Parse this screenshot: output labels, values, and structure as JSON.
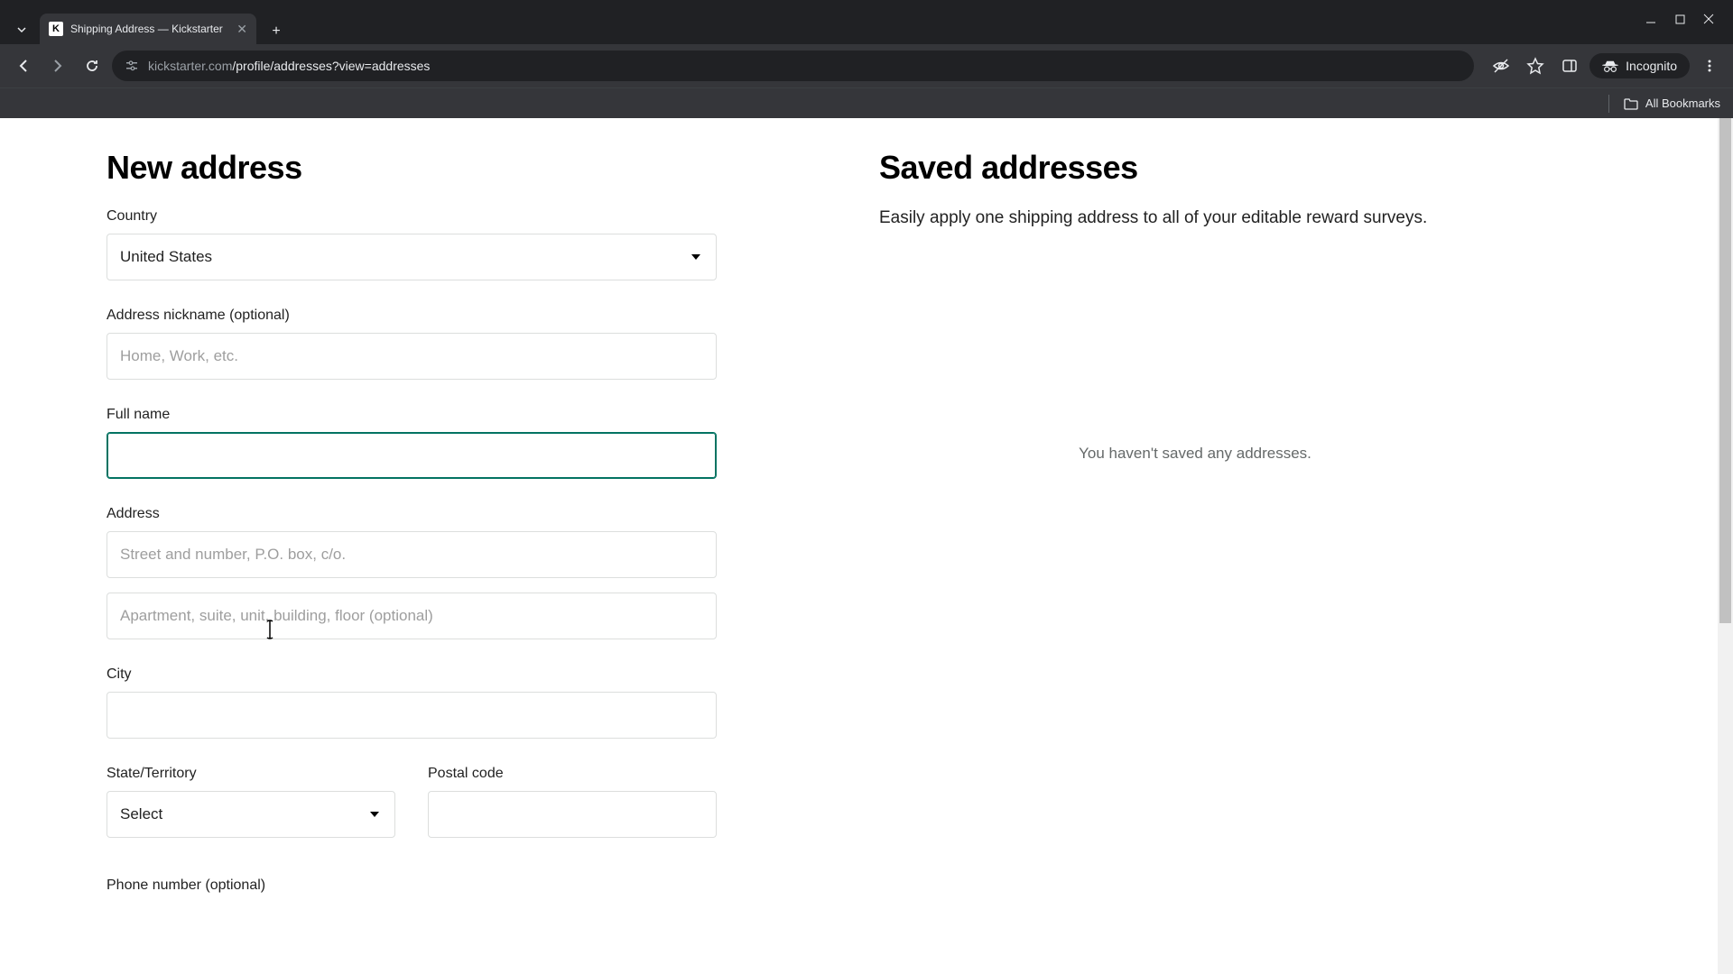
{
  "browser": {
    "tab_title": "Shipping Address — Kickstarter",
    "url_display_host": "kickstarter.com",
    "url_display_path": "/profile/addresses?view=addresses",
    "incognito_label": "Incognito",
    "all_bookmarks": "All Bookmarks"
  },
  "page": {
    "new_address_heading": "New address",
    "saved_heading": "Saved addresses",
    "saved_desc": "Easily apply one shipping address to all of your editable reward surveys.",
    "empty_saved": "You haven't saved any addresses.",
    "labels": {
      "country": "Country",
      "nickname": "Address nickname (optional)",
      "full_name": "Full name",
      "address": "Address",
      "city": "City",
      "state": "State/Territory",
      "postal": "Postal code",
      "phone": "Phone number (optional)"
    },
    "values": {
      "country": "United States",
      "state": "Select",
      "full_name": ""
    },
    "placeholders": {
      "nickname": "Home, Work, etc.",
      "address1": "Street and number, P.O. box, c/o.",
      "address2": "Apartment, suite, unit, building, floor (optional)"
    }
  }
}
